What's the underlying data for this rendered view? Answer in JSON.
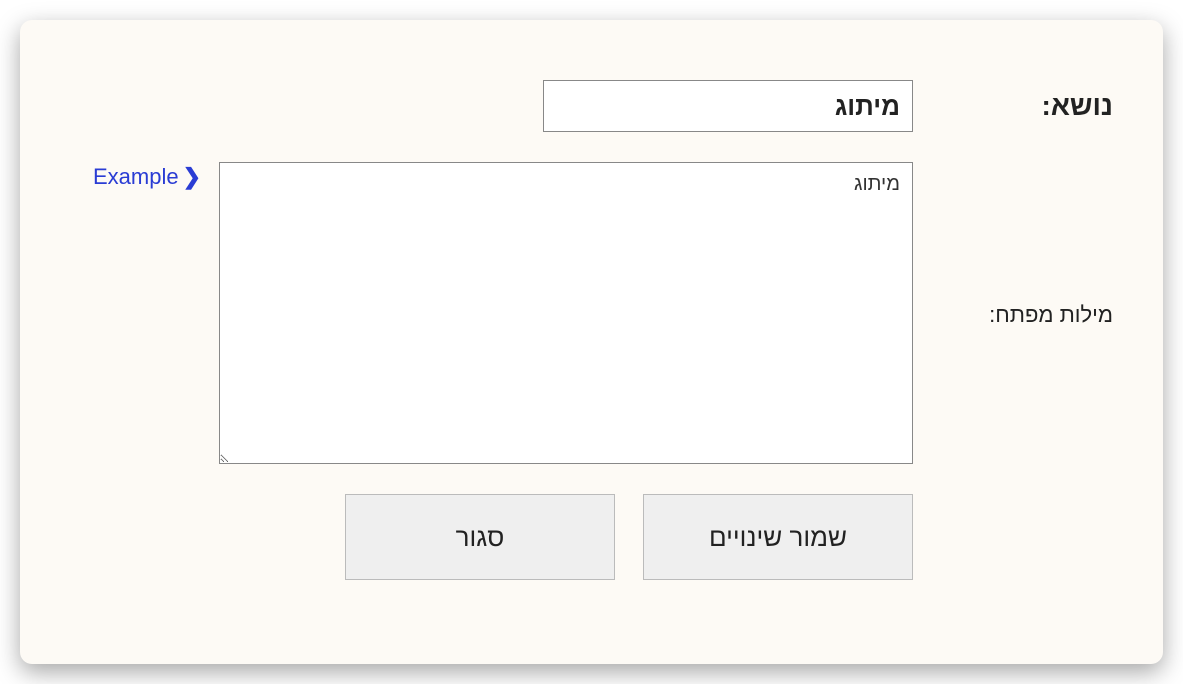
{
  "labels": {
    "subject": "נושא:",
    "keywords": "מילות מפתח:"
  },
  "fields": {
    "subject_value": "מיתוג",
    "keywords_value": "מיתוג"
  },
  "links": {
    "example": "Example"
  },
  "buttons": {
    "save": "שמור שינויים",
    "close": "סגור"
  }
}
